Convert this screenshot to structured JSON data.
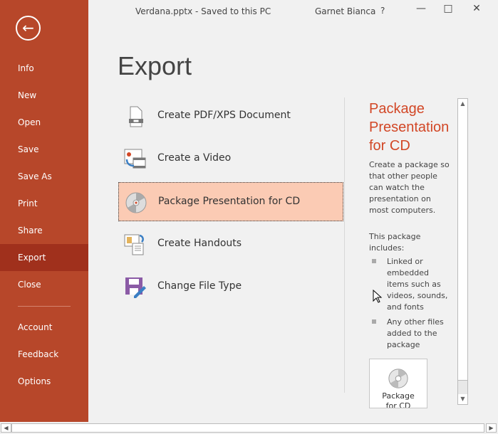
{
  "window": {
    "title": "Verdana.pptx  -  Saved to this PC",
    "user": "Garnet Bianca",
    "help": "?"
  },
  "sidebar": {
    "items": [
      {
        "label": "Info"
      },
      {
        "label": "New"
      },
      {
        "label": "Open"
      },
      {
        "label": "Save"
      },
      {
        "label": "Save As"
      },
      {
        "label": "Print"
      },
      {
        "label": "Share"
      },
      {
        "label": "Export"
      },
      {
        "label": "Close"
      },
      {
        "label": "Account"
      },
      {
        "label": "Feedback"
      },
      {
        "label": "Options"
      }
    ],
    "selected": "Export"
  },
  "main": {
    "title": "Export",
    "options": [
      {
        "label": "Create PDF/XPS Document",
        "icon": "pdf-document-icon"
      },
      {
        "label": "Create a Video",
        "icon": "video-icon"
      },
      {
        "label": "Package Presentation for CD",
        "icon": "cd-icon"
      },
      {
        "label": "Create Handouts",
        "icon": "handouts-icon"
      },
      {
        "label": "Change File Type",
        "icon": "save-as-type-icon"
      }
    ],
    "selected": "Package Presentation for CD"
  },
  "detail": {
    "heading": "Package Presentation for CD",
    "description": "Create a package so that other people can watch the presentation on most computers.",
    "includes_label": "This package includes:",
    "bullets": [
      "Linked or embedded items such as videos, sounds, and fonts",
      "Any other files added to the package"
    ],
    "button_label": "Package for CD"
  },
  "colors": {
    "accent": "#b7472a",
    "selected_nav": "#a0301c",
    "selected_option": "#fbcbb4",
    "heading": "#d24726"
  }
}
